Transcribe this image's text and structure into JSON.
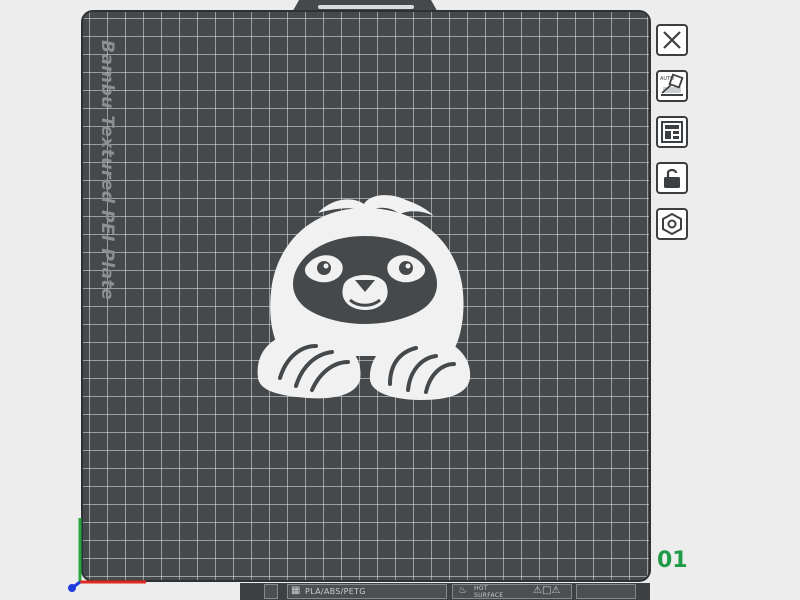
{
  "plate": {
    "name": "Bambu Textured PEI Plate",
    "filament_types": "PLA/ABS/PETG",
    "surface_line1": "HOT",
    "surface_line2": "SURFACE",
    "number": "01"
  },
  "model": {
    "name": "sloth"
  },
  "toolbar": {
    "buttons": [
      {
        "name": "close",
        "icon": "close-icon"
      },
      {
        "name": "auto-orient",
        "icon": "auto-orient-icon",
        "label": "AUTO"
      },
      {
        "name": "arrange",
        "icon": "arrange-icon"
      },
      {
        "name": "lock",
        "icon": "lock-icon"
      },
      {
        "name": "settings",
        "icon": "hexagon-settings-icon"
      }
    ]
  },
  "colors": {
    "plate": "#45494b",
    "grid": "#e1e5e7",
    "model": "#f1f1f1",
    "plate_number": "#1f9b49",
    "axis_x": "#e0281e",
    "axis_y": "#25a83c",
    "axis_z": "#1e3cdc"
  }
}
